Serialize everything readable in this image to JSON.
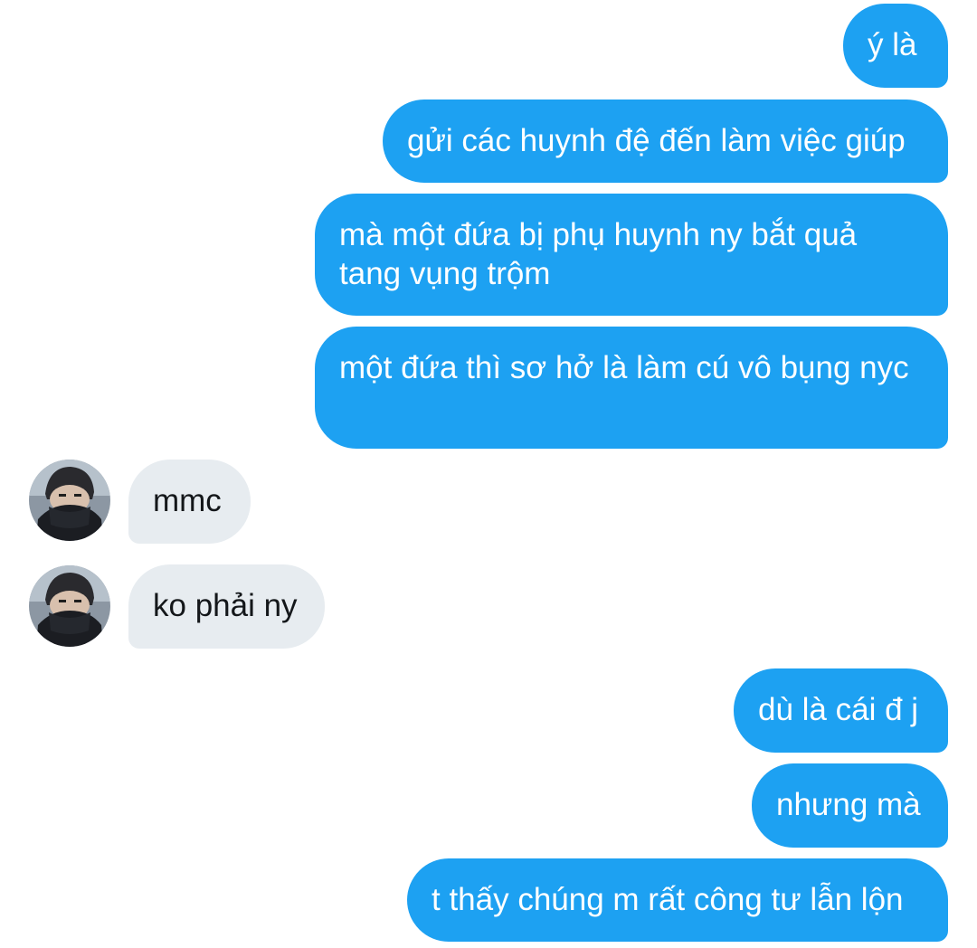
{
  "conversation": {
    "messages": [
      {
        "direction": "outgoing",
        "text": "ý là"
      },
      {
        "direction": "outgoing",
        "text": "gửi các huynh đệ đến làm việc giúp"
      },
      {
        "direction": "outgoing",
        "text": "mà một đứa bị phụ huynh ny bắt quả tang vụng trộm"
      },
      {
        "direction": "outgoing",
        "text": "một đứa thì sơ hở là làm cú vô bụng nyc"
      },
      {
        "direction": "incoming",
        "text": "mmc",
        "avatar_icon": "user-avatar"
      },
      {
        "direction": "incoming",
        "text": "ko phải ny",
        "avatar_icon": "user-avatar"
      },
      {
        "direction": "outgoing",
        "text": "dù là cái đ j"
      },
      {
        "direction": "outgoing",
        "text": "nhưng mà"
      },
      {
        "direction": "outgoing",
        "text": "t thấy chúng m rất công tư lẫn lộn"
      }
    ]
  },
  "colors": {
    "outgoing_bubble": "#1da1f2",
    "outgoing_text": "#ffffff",
    "incoming_bubble": "#e7ecf0",
    "incoming_text": "#14171a",
    "background": "#ffffff"
  }
}
